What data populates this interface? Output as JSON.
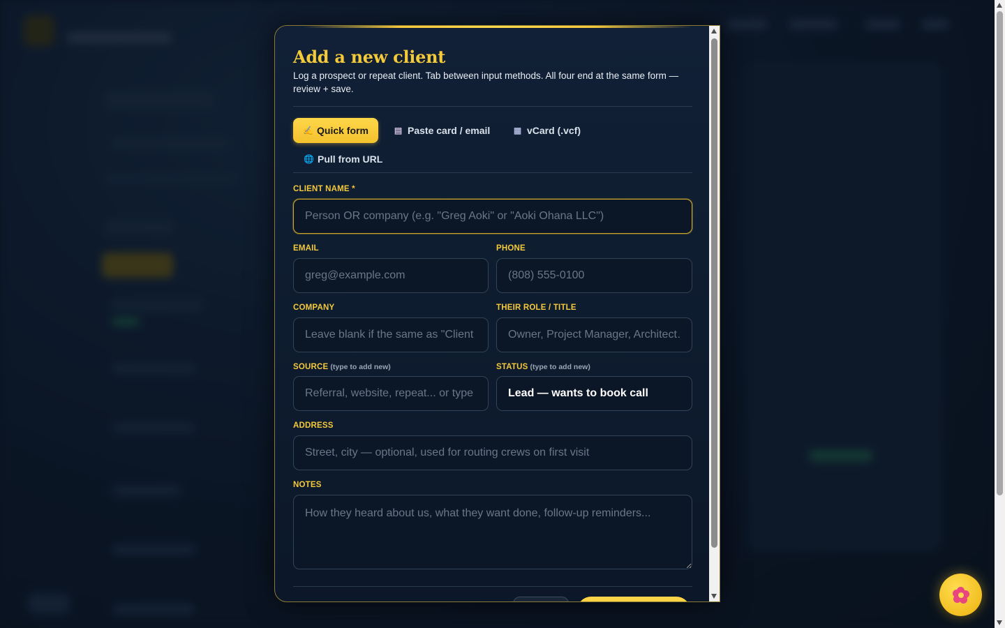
{
  "modal": {
    "title": "Add a new client",
    "subtitle": "Log a prospect or repeat client. Tab between input methods. All four end at the same form — review + save."
  },
  "tabs": [
    {
      "label": "Quick form",
      "icon": "pencil-icon",
      "glyph": "✍",
      "active": true
    },
    {
      "label": "Paste card / email",
      "icon": "clipboard-icon",
      "glyph": "▤",
      "active": false
    },
    {
      "label": "vCard (.vcf)",
      "icon": "contact-card-icon",
      "glyph": "▦",
      "active": false
    },
    {
      "label": "Pull from URL",
      "icon": "globe-icon",
      "glyph": "🌐",
      "active": false
    }
  ],
  "form": {
    "client_name": {
      "label": "CLIENT NAME *",
      "placeholder": "Person OR company (e.g. \"Greg Aoki\" or \"Aoki Ohana LLC\")",
      "value": ""
    },
    "email": {
      "label": "EMAIL",
      "placeholder": "greg@example.com",
      "value": ""
    },
    "phone": {
      "label": "PHONE",
      "placeholder": "(808) 555-0100",
      "value": ""
    },
    "company": {
      "label": "COMPANY",
      "placeholder": "Leave blank if the same as \"Client name\"",
      "value": ""
    },
    "role": {
      "label": "THEIR ROLE / TITLE",
      "placeholder": "Owner, Project Manager, Architect…",
      "value": ""
    },
    "source": {
      "label": "SOURCE",
      "hint": "(type to add new)",
      "placeholder": "Referral, website, repeat... or type",
      "value": ""
    },
    "status": {
      "label": "STATUS",
      "hint": "(type to add new)",
      "placeholder": "",
      "value": "Lead — wants to book call"
    },
    "address": {
      "label": "ADDRESS",
      "placeholder": "Street, city — optional, used for routing crews on first visit",
      "value": ""
    },
    "notes": {
      "label": "NOTES",
      "placeholder": "How they heard about us, what they want done, follow-up reminders...",
      "value": ""
    }
  },
  "fab": {
    "icon": "hibiscus-icon"
  },
  "colors": {
    "accent": "#f4c93a",
    "modal_bg": "#0f1d31",
    "field_bg": "#0b1626",
    "field_border": "#334357"
  }
}
